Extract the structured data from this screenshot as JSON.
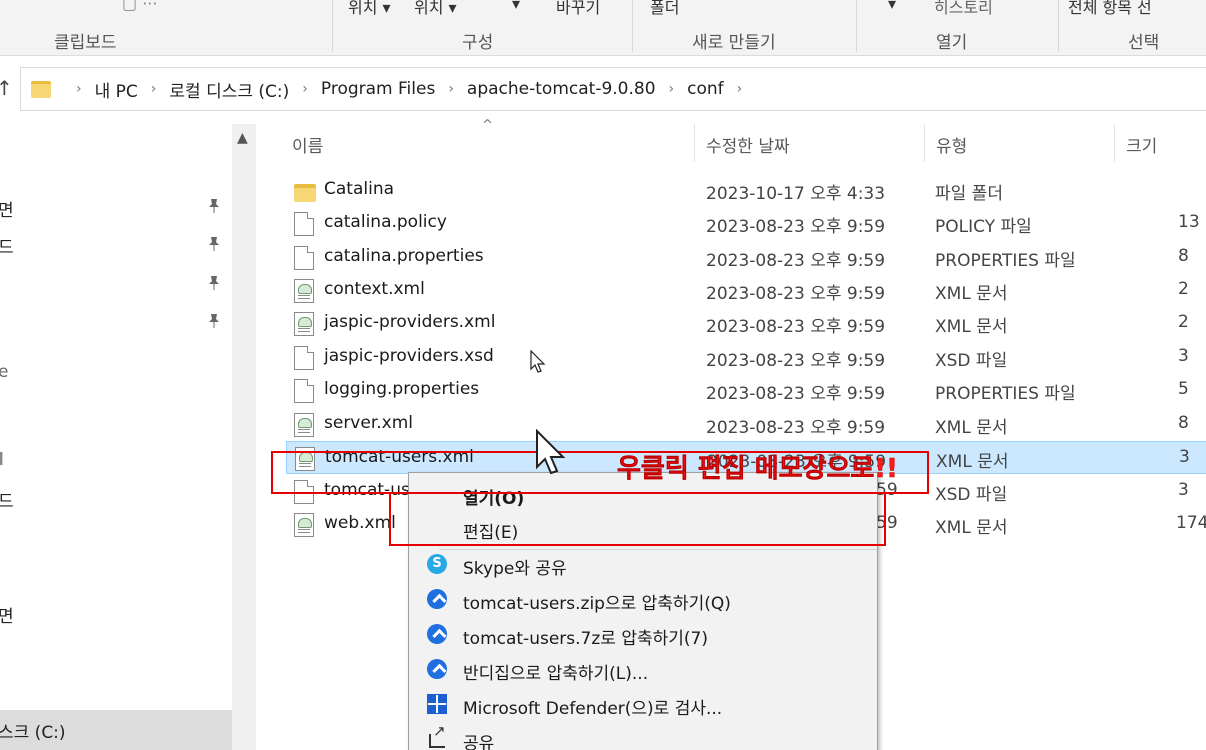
{
  "ribbon": {
    "top_items": [
      "위치 ▾",
      "위치 ▾",
      "▾",
      "바꾸기",
      "폴더",
      "▾",
      "히스토리",
      "전체 항목 선"
    ],
    "groups": [
      "클립보드",
      "구성",
      "새로 만들기",
      "열기",
      "선택"
    ]
  },
  "address": {
    "crumbs": [
      "내 PC",
      "로컬 디스크 (C:)",
      "Program Files",
      "apache-tomcat-9.0.80",
      "conf"
    ]
  },
  "nav": {
    "items": [
      "면",
      "드",
      "",
      "",
      "e",
      "l",
      "드",
      "면",
      "스크 (C:)"
    ]
  },
  "columns": {
    "name": "이름",
    "date": "수정한 날짜",
    "type": "유형",
    "size": "크기"
  },
  "files": [
    {
      "name": "Catalina",
      "date": "2023-10-17 오후 4:33",
      "type": "파일 폴더",
      "size": "",
      "icon": "folder-icon"
    },
    {
      "name": "catalina.policy",
      "date": "2023-08-23 오후 9:59",
      "type": "POLICY 파일",
      "size": "13",
      "icon": "file-icon"
    },
    {
      "name": "catalina.properties",
      "date": "2023-08-23 오후 9:59",
      "type": "PROPERTIES 파일",
      "size": "8",
      "icon": "file-icon"
    },
    {
      "name": "context.xml",
      "date": "2023-08-23 오후 9:59",
      "type": "XML 문서",
      "size": "2",
      "icon": "xml-file-icon"
    },
    {
      "name": "jaspic-providers.xml",
      "date": "2023-08-23 오후 9:59",
      "type": "XML 문서",
      "size": "2",
      "icon": "xml-file-icon"
    },
    {
      "name": "jaspic-providers.xsd",
      "date": "2023-08-23 오후 9:59",
      "type": "XSD 파일",
      "size": "3",
      "icon": "file-icon"
    },
    {
      "name": "logging.properties",
      "date": "2023-08-23 오후 9:59",
      "type": "PROPERTIES 파일",
      "size": "5",
      "icon": "file-icon"
    },
    {
      "name": "server.xml",
      "date": "2023-08-23 오후 9:59",
      "type": "XML 문서",
      "size": "8",
      "icon": "xml-file-icon"
    },
    {
      "name": "tomcat-users.xml",
      "date": "2023-08-23 오후 9:59",
      "type": "XML 문서",
      "size": "3",
      "icon": "xml-file-icon"
    },
    {
      "name": "tomcat-us",
      "date": "59",
      "type": "XSD 파일",
      "size": "3",
      "icon": "file-icon"
    },
    {
      "name": "web.xml",
      "date": "59",
      "type": "XML 문서",
      "size": "174",
      "icon": "xml-file-icon"
    }
  ],
  "context_menu": {
    "open": "열기(O)",
    "edit": "편집(E)",
    "skype": "Skype와 공유",
    "zip": "tomcat-users.zip으로 압축하기(Q)",
    "sevenz": "tomcat-users.7z로 압축하기(7)",
    "bandizip": "반디집으로 압축하기(L)...",
    "defender": "Microsoft Defender(으)로 검사...",
    "share": "공유",
    "skype_glyph": "S"
  },
  "annotation": {
    "text": "우클릭 편집 메모장으로!!",
    "color": "#ff1a1a"
  },
  "colors": {
    "selection": "#cce8ff",
    "folder": "#f7d774",
    "annotation_border": "#e60000"
  }
}
